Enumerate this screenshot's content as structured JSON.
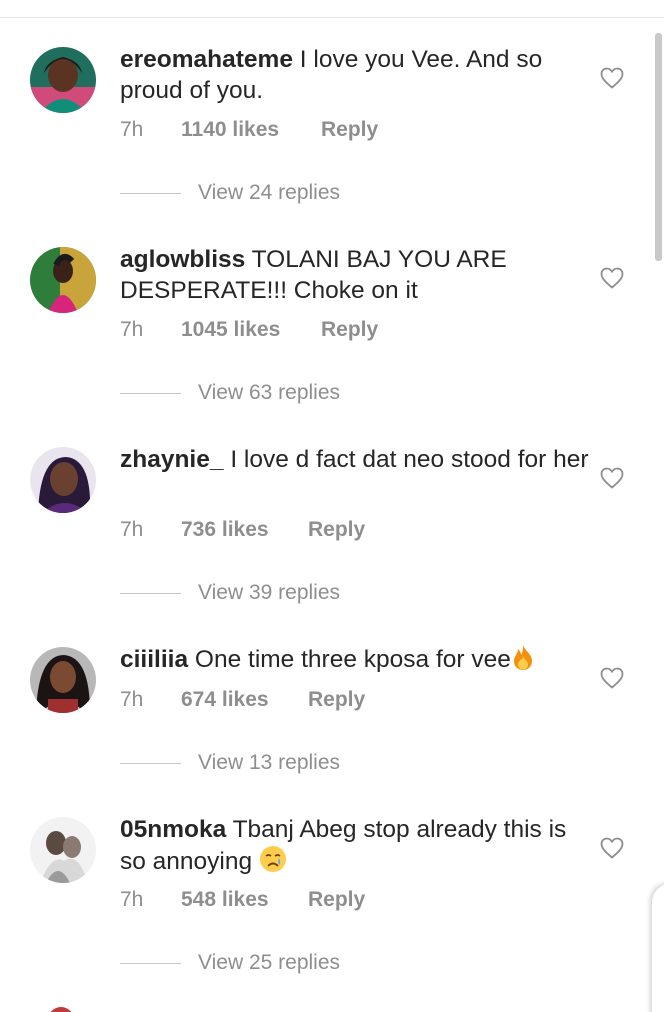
{
  "comments": [
    {
      "username": "ereomahateme",
      "text": "I love you Vee. And so proud of you.",
      "time": "7h",
      "likes": "1140 likes",
      "reply": "Reply",
      "view_replies": "View 24 replies"
    },
    {
      "username": "aglowbliss",
      "text": "TOLANI BAJ YOU ARE DESPERATE!!! Choke on it",
      "time": "7h",
      "likes": "1045 likes",
      "reply": "Reply",
      "view_replies": "View 63 replies"
    },
    {
      "username": "zhaynie_",
      "text": "I love d fact dat neo stood for her",
      "time": "7h",
      "likes": "736 likes",
      "reply": "Reply",
      "view_replies": "View 39 replies"
    },
    {
      "username": "ciiiliia",
      "text": "One time three kposa for vee",
      "emoji": "fire-emoji",
      "time": "7h",
      "likes": "674 likes",
      "reply": "Reply",
      "view_replies": "View 13 replies"
    },
    {
      "username": "05nmoka",
      "text": "Tbanj Abeg stop already this is so annoying",
      "emoji": "crying-face-emoji",
      "time": "7h",
      "likes": "548 likes",
      "reply": "Reply",
      "view_replies": "View 25 replies"
    }
  ],
  "colors": {
    "text": "#262626",
    "meta": "#8e8e8e",
    "divider": "#c7c7c7"
  }
}
